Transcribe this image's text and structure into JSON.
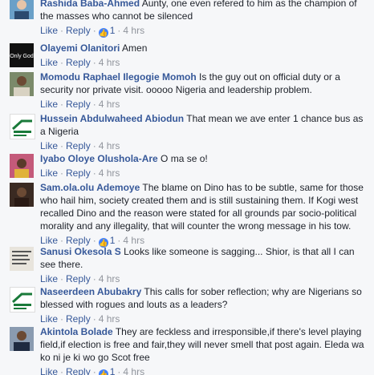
{
  "comments": [
    {
      "author": "Rashida Baba-Ahmed",
      "text": "Aunty, one even refered to him as the champion of the masses who cannot be silenced",
      "likes": "1",
      "time": "4 hrs",
      "avatar_bg": "#6aa0c8"
    },
    {
      "author": "Olayemi Olanitori",
      "text": "Amen",
      "likes": "",
      "time": "4 hrs",
      "avatar_bg": "#111111",
      "avatar_text": "Only God"
    },
    {
      "author": "Momodu Raphael Ilegogie Momoh",
      "text": "Is the guy out on official duty or a security nor private visit. ooooo Nigeria and leadership problem.",
      "likes": "",
      "time": "4 hrs",
      "avatar_bg": "#7b8a6a"
    },
    {
      "author": "Hussein Abdulwaheed Abiodun",
      "text": "That mean we ave enter 1 chance bus as a Nigeria",
      "likes": "",
      "time": "4 hrs",
      "avatar_bg": "#ffffff"
    },
    {
      "author": "Iyabo Oloye Olushola-Are",
      "text": "O ma se o!",
      "likes": "",
      "time": "4 hrs",
      "avatar_bg": "#c45a7a"
    },
    {
      "author": "Sam.ola.olu Ademoye",
      "text": "The blame on Dino has to be subtle, same for those who hail him, society created them and is still sustaining them. If Kogi west recalled Dino and the reason were stated for all grounds par socio-political morality and any illegality, that will counter the wrong message in his tow.",
      "likes": "1",
      "time": "4 hrs",
      "avatar_bg": "#3a2a22"
    },
    {
      "author": "Sanusi Okesola S",
      "text": "Looks like someone is sagging... Shior, is that all I can see there.",
      "likes": "",
      "time": "4 hrs",
      "avatar_bg": "#e8e4dc"
    },
    {
      "author": "Naseerdeen Abubakry",
      "text": "This calls for sober reflection; why are Nigerians so blessed with rogues and louts as a leaders?",
      "likes": "",
      "time": "4 hrs",
      "avatar_bg": "#ffffff"
    },
    {
      "author": "Akintola Bolade",
      "text": "They are feckless and irresponsible,if there's level playing field,if election is free and fair,they will never smell that post again. Eleda wa ko ni je ki wo go Scot free",
      "likes": "1",
      "time": "4 hrs",
      "avatar_bg": "#8a9bb0"
    }
  ],
  "labels": {
    "like": "Like",
    "reply": "Reply",
    "sep": "·"
  },
  "colors": {
    "link": "#365899",
    "meta": "#90949c",
    "like_badge": "#4080ff"
  }
}
